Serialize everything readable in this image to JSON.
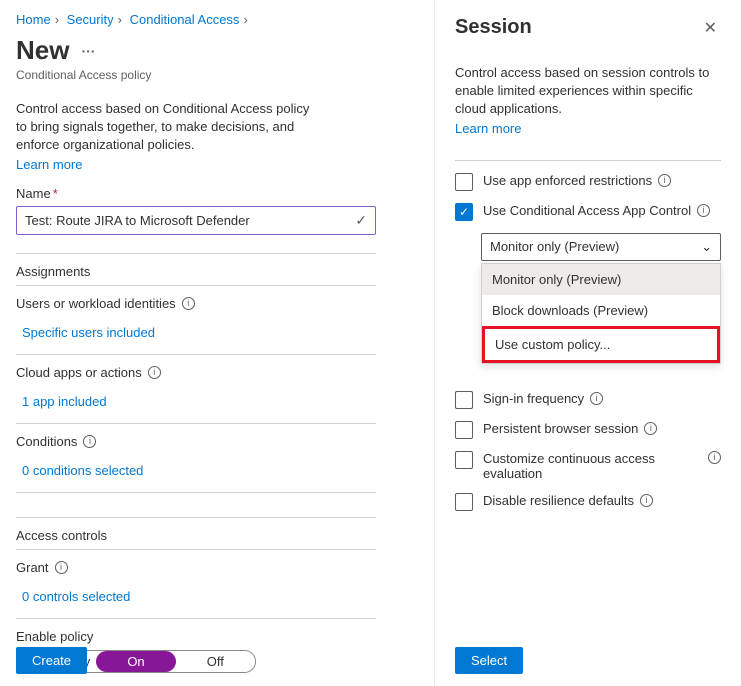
{
  "breadcrumb": {
    "home": "Home",
    "security": "Security",
    "ca": "Conditional Access"
  },
  "left": {
    "title": "New",
    "subtitle": "Conditional Access policy",
    "desc": "Control access based on Conditional Access policy to bring signals together, to make decisions, and enforce organizational policies.",
    "learn": "Learn more",
    "name_label": "Name",
    "name_value": "Test: Route JIRA to Microsoft Defender",
    "assignments": "Assignments",
    "users_label": "Users or workload identities",
    "users_value": "Specific users included",
    "apps_label": "Cloud apps or actions",
    "apps_value": "1 app included",
    "cond_label": "Conditions",
    "cond_value": "0 conditions selected",
    "access_controls": "Access controls",
    "grant_label": "Grant",
    "grant_value": "0 controls selected",
    "enable_label": "Enable policy",
    "pill_report": "Report-only",
    "pill_on": "On",
    "pill_off": "Off",
    "create": "Create"
  },
  "right": {
    "title": "Session",
    "desc": "Control access based on session controls to enable limited experiences within specific cloud applications.",
    "learn": "Learn more",
    "c1": "Use app enforced restrictions",
    "c2": "Use Conditional Access App Control",
    "select_val": "Monitor only (Preview)",
    "opt1": "Monitor only (Preview)",
    "opt2": "Block downloads (Preview)",
    "opt3": "Use custom policy...",
    "c3": "Sign-in frequency",
    "c4": "Persistent browser session",
    "c5": "Customize continuous access evaluation",
    "c6": "Disable resilience defaults",
    "select": "Select"
  }
}
